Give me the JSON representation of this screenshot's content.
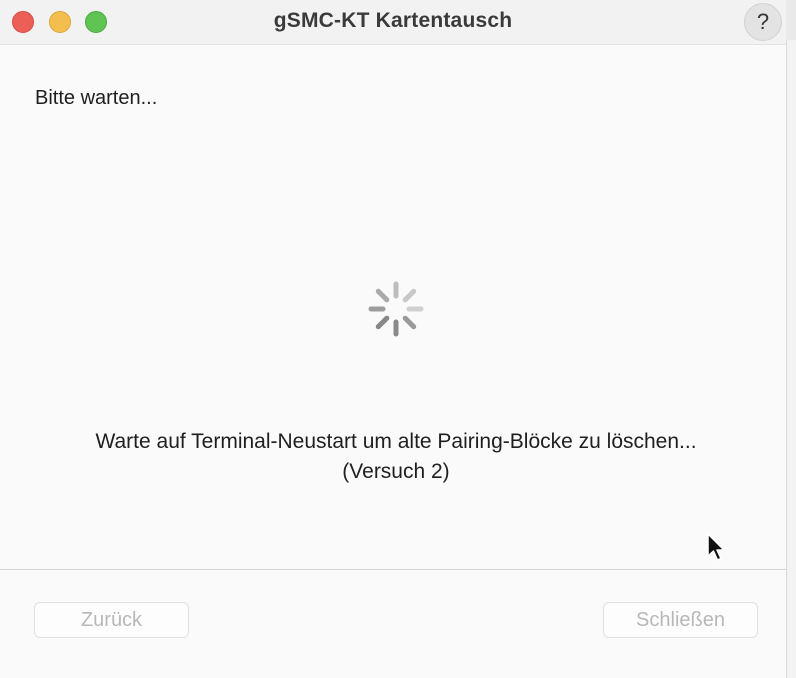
{
  "window": {
    "title": "gSMC-KT Kartentausch",
    "help_label": "?"
  },
  "content": {
    "heading": "Bitte warten...",
    "status_line1": "Warte auf Terminal-Neustart um alte Pairing-Blöcke zu löschen...",
    "status_line2": "(Versuch 2)"
  },
  "footer": {
    "back_label": "Zurück",
    "close_label": "Schließen"
  },
  "colors": {
    "close": "#ec5f57",
    "minimize": "#f4be4f",
    "maximize": "#5fc453"
  },
  "icons": {
    "spinner": "progress-spinner-icon",
    "cursor": "mouse-pointer-icon"
  }
}
